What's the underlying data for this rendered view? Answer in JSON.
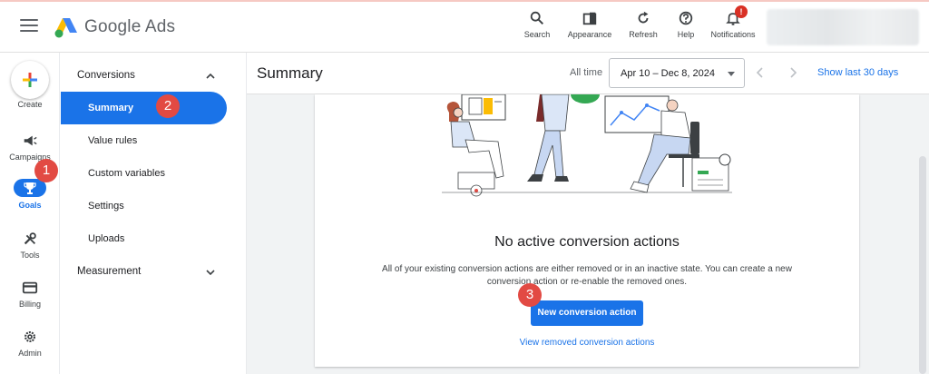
{
  "header": {
    "brand": "Google Ads",
    "tools": [
      {
        "label": "Search",
        "icon": "search-icon"
      },
      {
        "label": "Appearance",
        "icon": "appearance-icon"
      },
      {
        "label": "Refresh",
        "icon": "refresh-icon"
      },
      {
        "label": "Help",
        "icon": "help-icon"
      },
      {
        "label": "Notifications",
        "icon": "bell-icon",
        "badge": "!"
      }
    ]
  },
  "rail": {
    "create": "Create",
    "items": [
      {
        "label": "Campaigns",
        "icon": "megaphone-icon"
      },
      {
        "label": "Goals",
        "icon": "trophy-icon",
        "active": true
      },
      {
        "label": "Tools",
        "icon": "tools-icon"
      },
      {
        "label": "Billing",
        "icon": "credit-card-icon"
      },
      {
        "label": "Admin",
        "icon": "gear-icon"
      }
    ]
  },
  "subnav": {
    "section1": "Conversions",
    "items": [
      "Summary",
      "Value rules",
      "Custom variables",
      "Settings",
      "Uploads"
    ],
    "section2": "Measurement"
  },
  "main": {
    "title": "Summary",
    "date_label": "All time",
    "date_range": "Apr 10 – Dec 8, 2024",
    "show_last": "Show last 30 days"
  },
  "empty_state": {
    "title": "No active conversion actions",
    "description": "All of your existing conversion actions are either removed or in an inactive state. You can create a new conversion action or re-enable the removed ones.",
    "primary_button": "New conversion action",
    "secondary_link": "View removed conversion actions"
  },
  "markers": [
    "1",
    "2",
    "3"
  ],
  "colors": {
    "accent": "#1a73e8",
    "marker": "#e24a43",
    "badge": "#d93025"
  }
}
